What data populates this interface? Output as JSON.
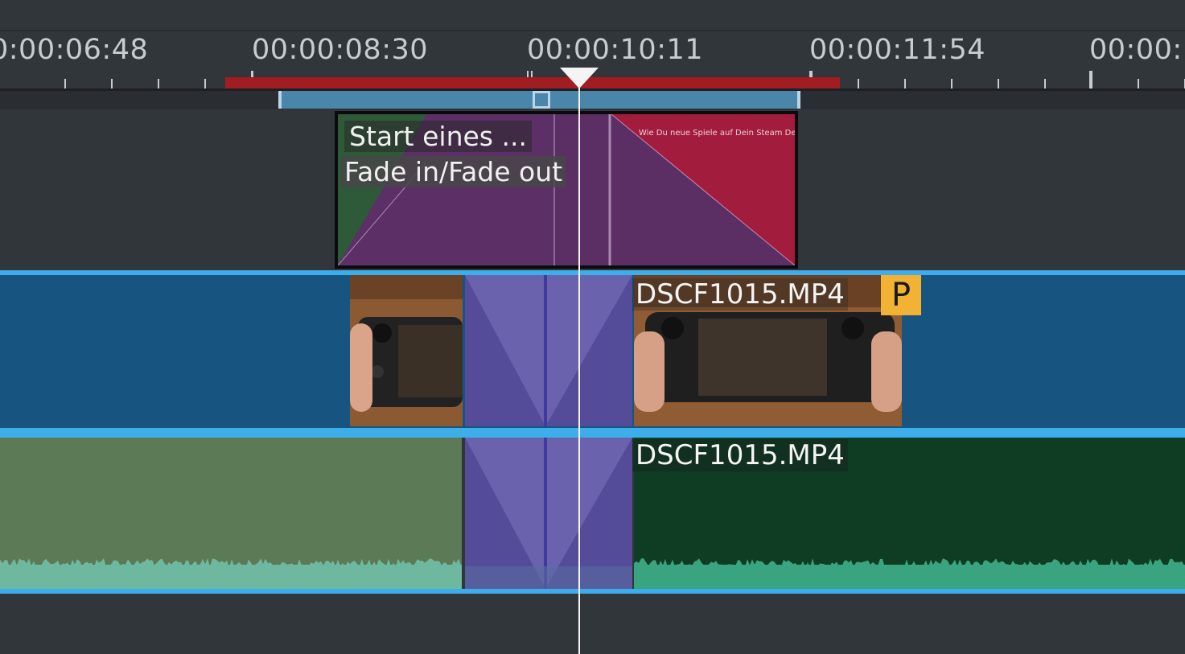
{
  "ruler": {
    "timecodes": [
      "0:00:06:48",
      "00:00:08:30",
      "00:00:10:11",
      "00:00:11:54",
      "00:00:"
    ]
  },
  "title_clip": {
    "label": "Start eines ...",
    "effect": "Fade in/Fade out",
    "thumbnail_text": "Wie Du neue Spiele auf Dein Steam Deck",
    "colors": {
      "purple": "#5b2f63",
      "red": "#a21c3d",
      "green": "#2f5a3a"
    }
  },
  "video_track": {
    "clip_name": "DSCF1015.MP4",
    "proxy_badge": "P",
    "colors": {
      "track": "#185480",
      "transition": "#6a62ac",
      "selection": "#3daee9"
    }
  },
  "audio_track": {
    "clip_name": "DSCF1015.MP4",
    "colors": {
      "left_clip": "#5b7a55",
      "right_clip": "#0e3d24",
      "wave_left": "#6fb8a0",
      "wave_right": "#3aa37f"
    }
  },
  "preview_range_color": "#a11d22",
  "playhead_color": "#f4f4f4"
}
